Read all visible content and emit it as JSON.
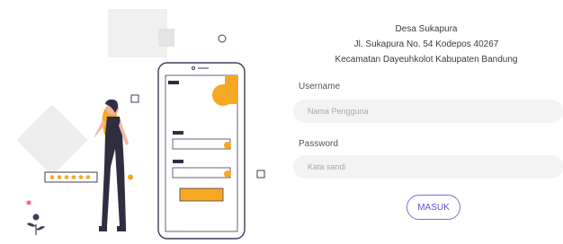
{
  "header": {
    "line1": "Desa Sukapura",
    "line2": "Jl. Sukapura No. 54 Kodepos 40267",
    "line3": "Kecamatan Dayeuhkolot Kabupaten Bandung"
  },
  "form": {
    "username_label": "Username",
    "username_placeholder": "Nama Pengguna",
    "username_value": "",
    "password_label": "Password",
    "password_placeholder": "Kata sandi",
    "password_value": "",
    "submit_label": "MASUK"
  },
  "colors": {
    "accent": "#f7a823",
    "dark": "#2f2e41",
    "button_border": "#7c6fd9"
  }
}
